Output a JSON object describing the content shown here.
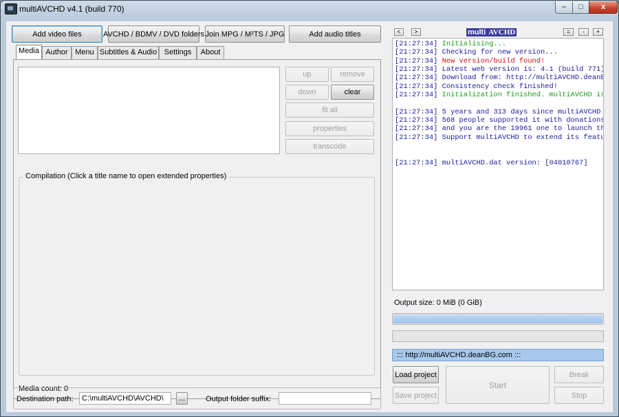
{
  "window": {
    "title": "multiAVCHD v4.1 (build 770)",
    "controls": {
      "minimize": "–",
      "maximize": "□",
      "close": "x"
    }
  },
  "toolbar": {
    "add_video": "Add video files",
    "avchd_folders": "AVCHD / BDMV / DVD folders",
    "join_mpg": "Join MPG / M²TS / JPG",
    "add_audio": "Add audio titles"
  },
  "tabs": [
    "Media",
    "Author",
    "Menu",
    "Subtitles & Audio",
    "Settings",
    "About"
  ],
  "media": {
    "buttons": {
      "up": "up",
      "remove": "remove",
      "down": "down",
      "clear": "clear",
      "fit_all": "fit all",
      "properties": "properties",
      "transcode": "transcode"
    },
    "compilation_label": "Compilation (Click a title name to open extended properties)",
    "media_count": "Media count: 0"
  },
  "destination": {
    "label": "Destination path:",
    "value": "C:\\multiAVCHD\\AVCHD\\",
    "browse": "...",
    "suffix_label": "Output folder suffix:",
    "suffix_value": ""
  },
  "right_panel": {
    "nav_prev": "<",
    "nav_next": ">",
    "logo_multi": "multi",
    "logo_avchd": "AVCHD",
    "win_min": "=",
    "win_mid": "-",
    "win_plus": "+",
    "log": [
      {
        "ts": "[21:27:34]",
        "msg": "Initialising...",
        "color": "#1a9a1a"
      },
      {
        "ts": "[21:27:34]",
        "msg": "Checking for new version...",
        "color": "#1a1aa0"
      },
      {
        "ts": "[21:27:34]",
        "msg": "New version/build found!",
        "color": "#d01010"
      },
      {
        "ts": "[21:27:34]",
        "msg": "Latest web version is: 4.1 (build 771)",
        "color": "#1a1aa0"
      },
      {
        "ts": "[21:27:34]",
        "msg": "Download from: http://multiAVCHD.deanBG",
        "color": "#1a1aa0"
      },
      {
        "ts": "[21:27:34]",
        "msg": "Consistency check finished!",
        "color": "#1a1aa0"
      },
      {
        "ts": "[21:27:34]",
        "msg": "Initialization finished. multiAVCHD is",
        "color": "#1a9a1a"
      },
      {
        "ts": "",
        "msg": "",
        "color": ""
      },
      {
        "ts": "[21:27:34]",
        "msg": "5 years and 313 days since multiAVCHD v",
        "color": "#1a1aa0"
      },
      {
        "ts": "[21:27:34]",
        "msg": "568 people supported it with donations",
        "color": "#1a1aa0"
      },
      {
        "ts": "[21:27:34]",
        "msg": "and you are the 19961 one to launch the",
        "color": "#1a1aa0"
      },
      {
        "ts": "[21:27:34]",
        "msg": "Support multiAVCHD to extend its featu",
        "color": "#1a1aa0"
      },
      {
        "ts": "",
        "msg": "",
        "color": ""
      },
      {
        "ts": "",
        "msg": "",
        "color": ""
      },
      {
        "ts": "[21:27:34]",
        "msg": "multiAVCHD.dat version: [04010767]",
        "color": "#1a1aa0"
      }
    ],
    "output_size": "Output size: 0 MiB (0 GiB)",
    "progress1": 1.0,
    "progress2": 0.0,
    "url": "::: http://multiAVCHD.deanBG.com :::",
    "load_project": "Load project",
    "save_project": "Save project",
    "start": "Start",
    "break": "Break",
    "stop": "Stop"
  }
}
